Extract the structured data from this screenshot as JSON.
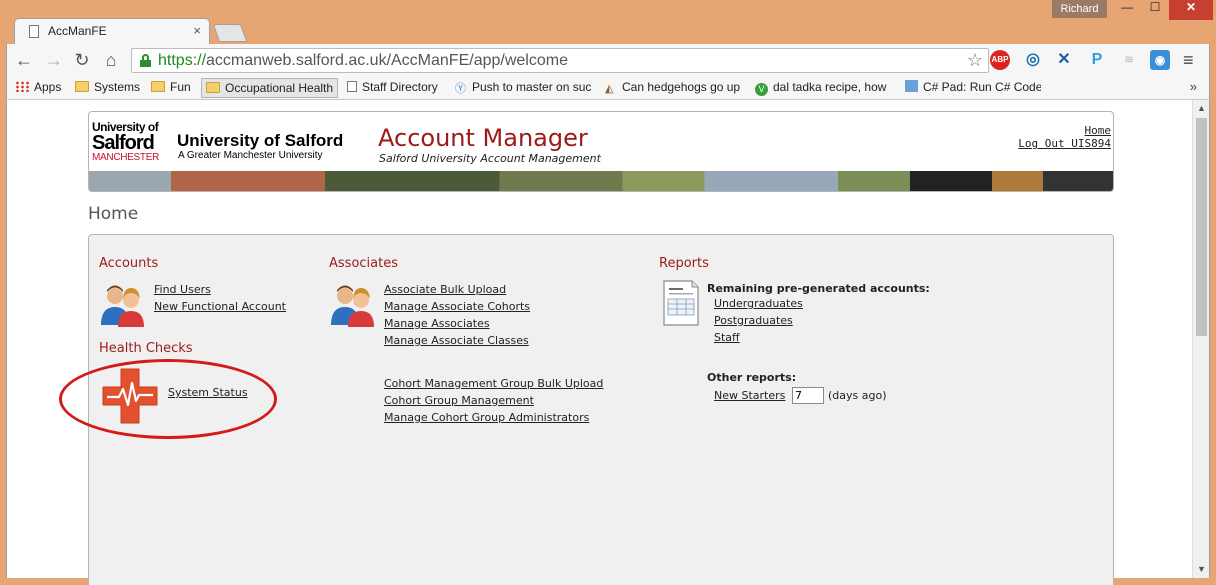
{
  "browser": {
    "tab_title": "AccManFE",
    "tab_close": "×",
    "user": "Richard",
    "win_min": "—",
    "win_max": "☐",
    "win_close": "✕",
    "url_scheme": "https://",
    "url_rest": "accmanweb.salford.ac.uk/AccManFE/app/welcome",
    "bookmarks": [
      {
        "label": "Apps"
      },
      {
        "label": "Systems"
      },
      {
        "label": "Fun"
      },
      {
        "label": "Occupational Health"
      },
      {
        "label": "Staff Directory"
      },
      {
        "label": "Push to master on suc"
      },
      {
        "label": "Can hedgehogs go up"
      },
      {
        "label": "dal tadka recipe, how"
      },
      {
        "label": "C# Pad: Run C# Code"
      }
    ],
    "extensions": {
      "abp": "ABP",
      "p": "P"
    }
  },
  "header": {
    "logo_line1": "University of",
    "logo_line2": "Salford",
    "logo_line3": "MANCHESTER",
    "logo_name": "University of Salford",
    "logo_sub": "A Greater Manchester University",
    "app_title": "Account Manager",
    "app_subtitle": "Salford University Account Management",
    "home_link": "Home",
    "logout_link": "Log Out UIS894"
  },
  "page_title": "Home",
  "accounts": {
    "heading": "Accounts",
    "links": [
      "Find Users",
      "New Functional Account"
    ]
  },
  "health": {
    "heading": "Health Checks",
    "link": "System Status"
  },
  "associates": {
    "heading": "Associates",
    "links": [
      "Associate Bulk Upload",
      "Manage Associate Cohorts",
      "Manage Associates",
      "Manage Associate Classes"
    ],
    "cohort_links": [
      "Cohort Management Group Bulk Upload",
      "Cohort Group Management",
      "Manage Cohort Group Administrators"
    ]
  },
  "reports": {
    "heading": "Reports",
    "remaining_label": "Remaining pre-generated accounts:",
    "remaining_links": [
      "Undergraduates",
      "Postgraduates",
      "Staff"
    ],
    "other_label": "Other reports:",
    "new_starters_link": "New Starters",
    "days_value": "7",
    "days_suffix": "(days ago)"
  },
  "colors": {
    "accent": "#9b1a1a",
    "annotation": "#d21c1c",
    "frame": "#e6a573"
  }
}
